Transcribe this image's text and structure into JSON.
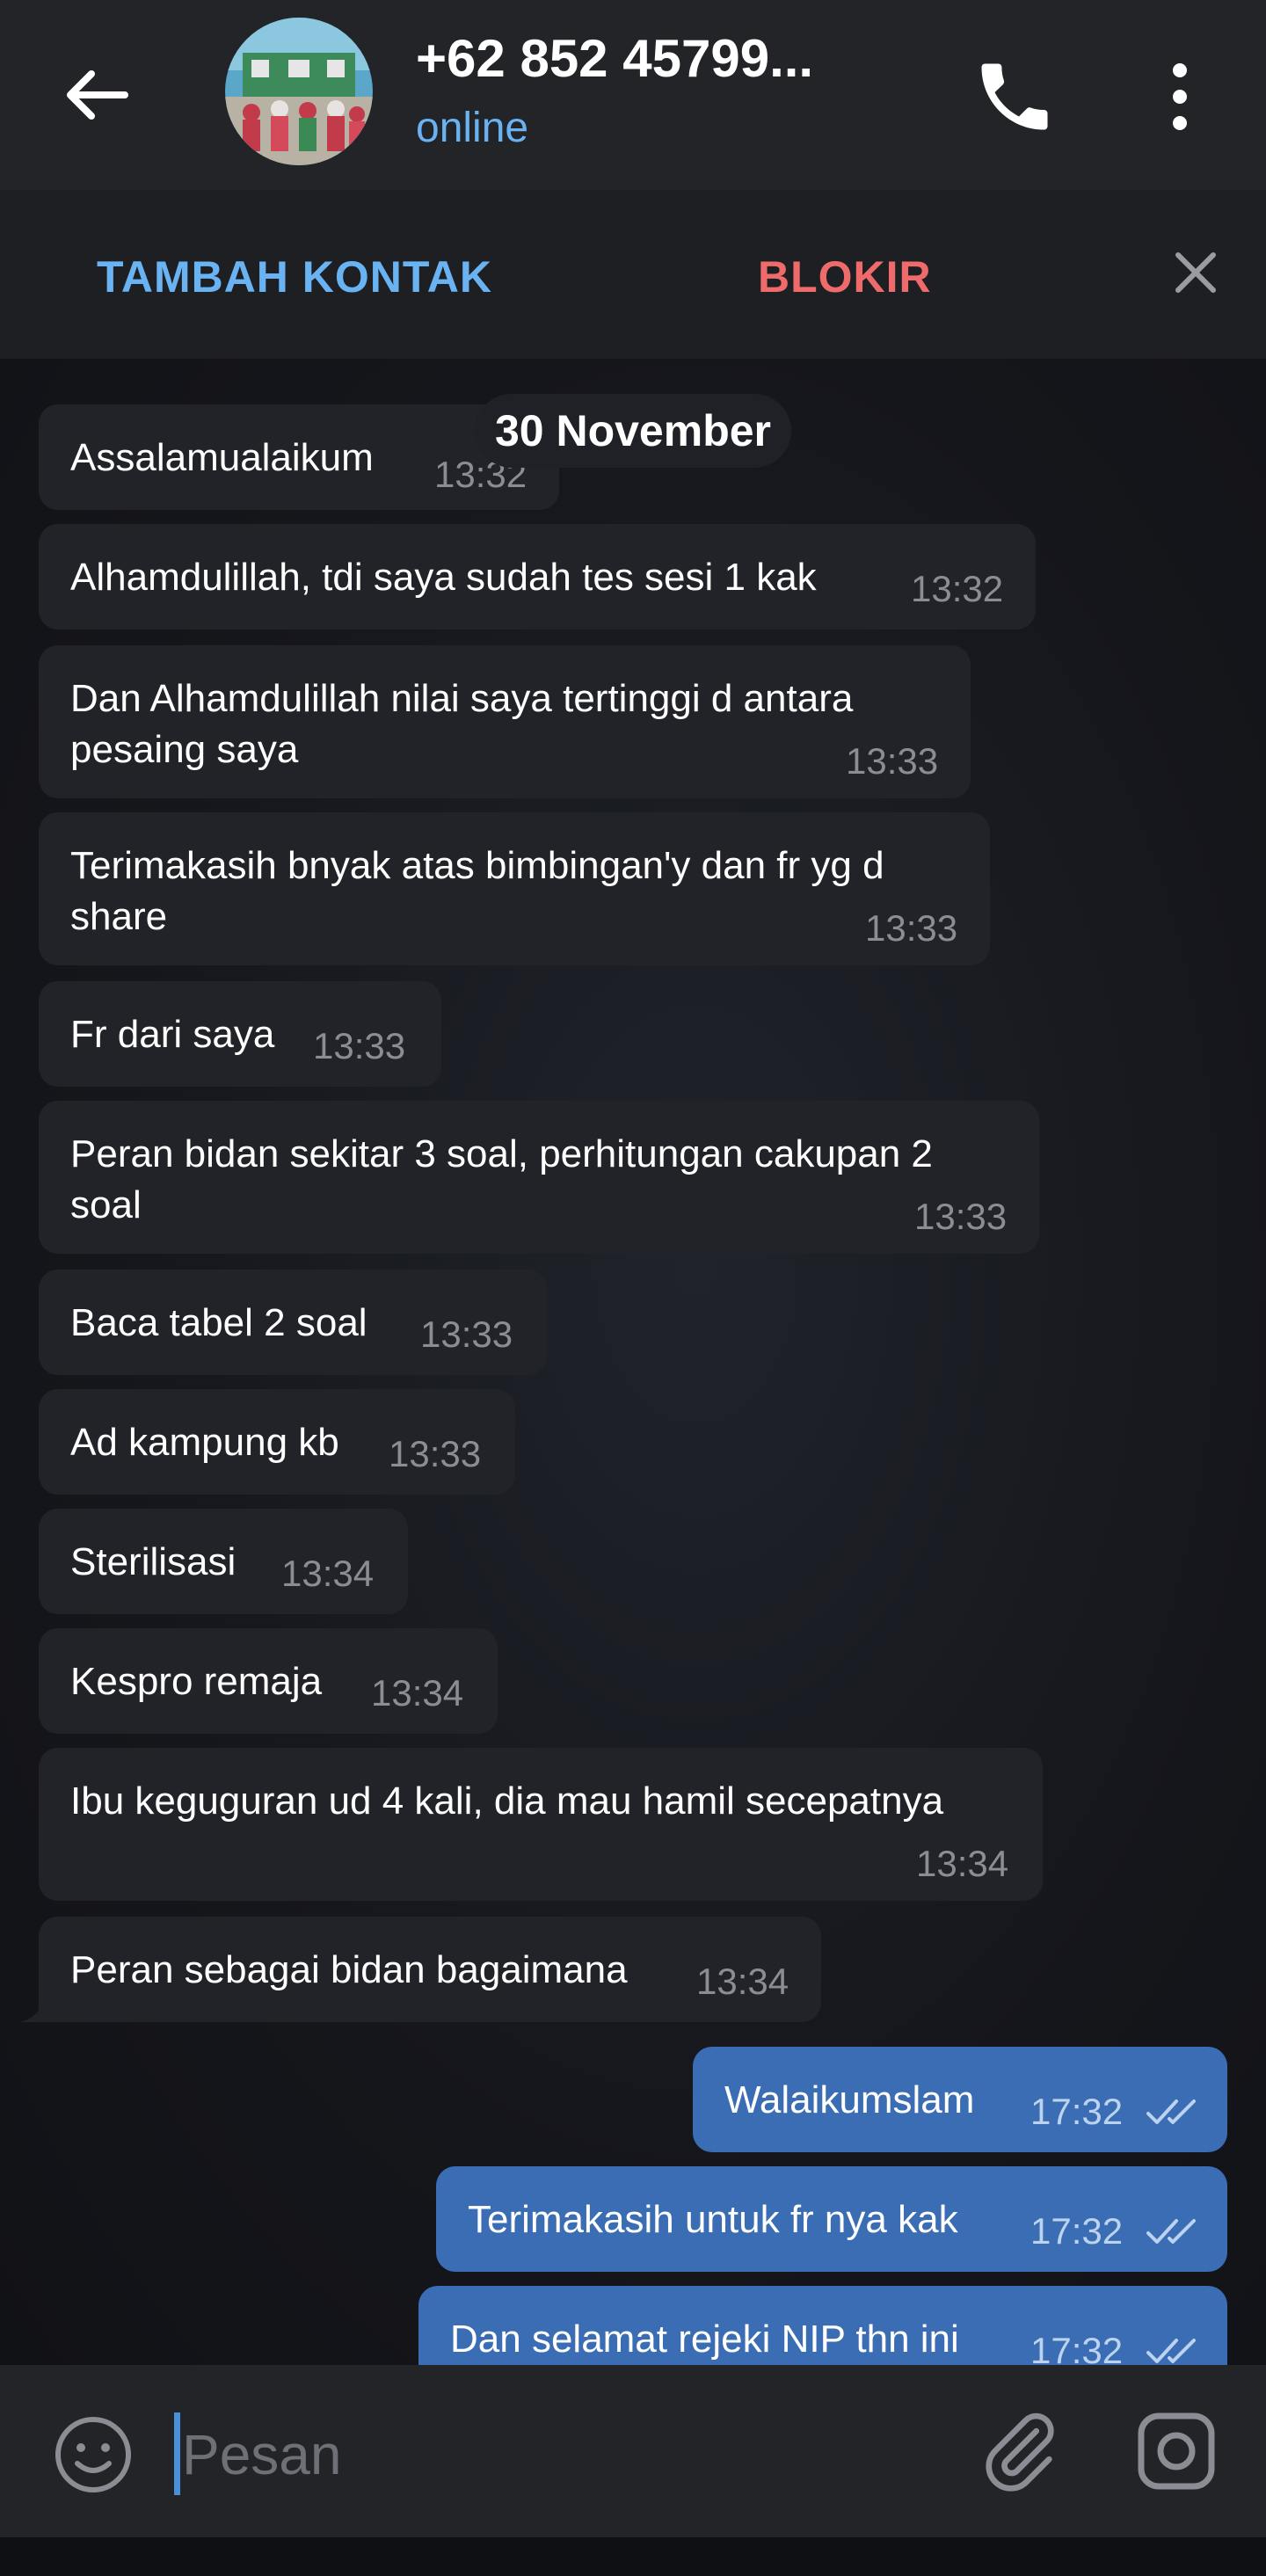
{
  "header": {
    "title": "+62 852 45799...",
    "status": "online",
    "avatar_alt": "contact-photo"
  },
  "action_bar": {
    "add_contact": "TAMBAH KONTAK",
    "block": "BLOKIR"
  },
  "date_divider": "30 November",
  "messages": [
    {
      "dir": "in",
      "text": "Assalamualaikum",
      "time": "13:32"
    },
    {
      "dir": "in",
      "text": "Alhamdulillah, tdi saya sudah tes sesi 1 kak",
      "time": "13:32"
    },
    {
      "dir": "in",
      "text": "Dan Alhamdulillah nilai saya tertinggi d antara\npesaing saya",
      "time": "13:33"
    },
    {
      "dir": "in",
      "text": "Terimakasih bnyak atas bimbingan'y dan fr yg d\nshare",
      "time": "13:33"
    },
    {
      "dir": "in",
      "text": "Fr dari saya",
      "time": "13:33"
    },
    {
      "dir": "in",
      "text": "Peran bidan sekitar 3 soal, perhitungan cakupan 2\nsoal",
      "time": "13:33"
    },
    {
      "dir": "in",
      "text": "Baca tabel 2 soal",
      "time": "13:33"
    },
    {
      "dir": "in",
      "text": "Ad kampung kb",
      "time": "13:33"
    },
    {
      "dir": "in",
      "text": "Sterilisasi",
      "time": "13:34"
    },
    {
      "dir": "in",
      "text": "Kespro remaja",
      "time": "13:34"
    },
    {
      "dir": "in",
      "text": "Ibu keguguran ud 4 kali, dia mau hamil secepatnya",
      "time": "13:34"
    },
    {
      "dir": "in",
      "text": "Peran sebagai bidan bagaimana",
      "time": "13:34"
    },
    {
      "dir": "out",
      "text": "Walaikumslam",
      "time": "17:32"
    },
    {
      "dir": "out",
      "text": "Terimakasih untuk fr nya kak",
      "time": "17:32"
    },
    {
      "dir": "out",
      "text": "Dan selamat rejeki NIP thn ini",
      "time": "17:32"
    }
  ],
  "input": {
    "placeholder": "Pesan"
  },
  "colors": {
    "accent": "#6ab3f3",
    "danger": "#ef6b6b",
    "outgoing_bubble": "#3a6db3",
    "incoming_bubble": "#222328"
  }
}
